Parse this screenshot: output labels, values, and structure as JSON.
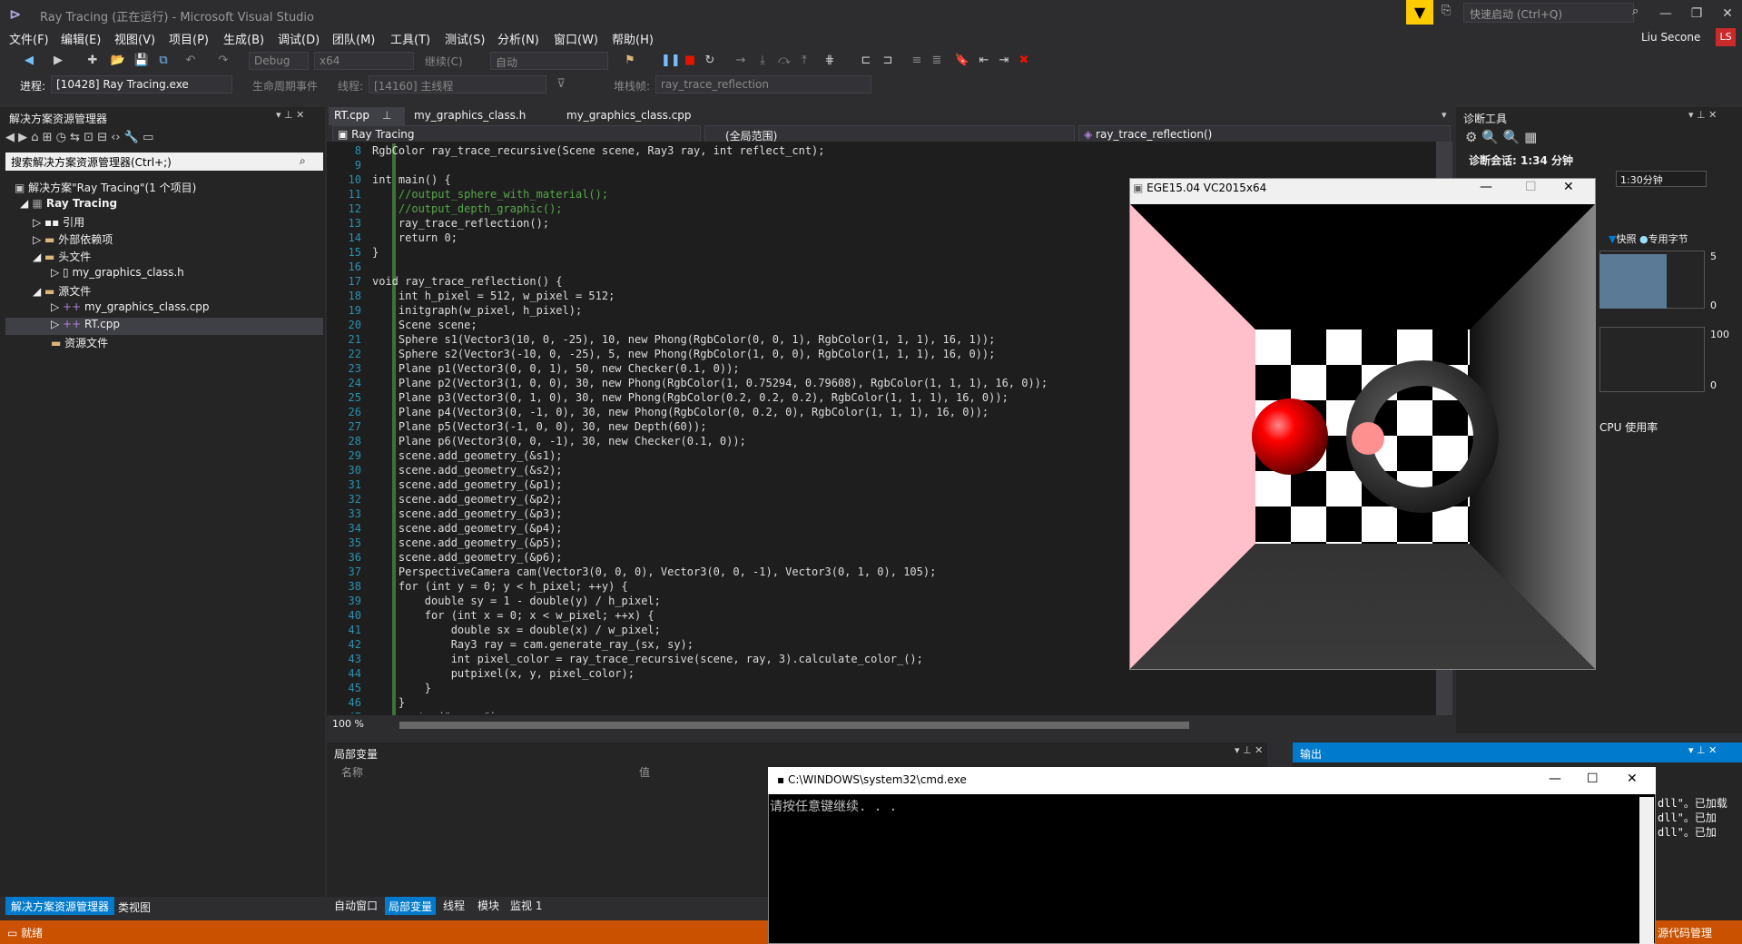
{
  "titlebar": {
    "title": "Ray Tracing (正在运行) - Microsoft Visual Studio",
    "quick_launch_placeholder": "快速启动 (Ctrl+Q)",
    "user": "Liu Secone",
    "avatar": "LS"
  },
  "menu": [
    "文件(F)",
    "编辑(E)",
    "视图(V)",
    "项目(P)",
    "生成(B)",
    "调试(D)",
    "团队(M)",
    "工具(T)",
    "测试(S)",
    "分析(N)",
    "窗口(W)",
    "帮助(H)"
  ],
  "toolbar": {
    "config": "Debug",
    "platform": "x64",
    "continue": "继续(C)",
    "auto": "自动"
  },
  "debugbar": {
    "process_label": "进程:",
    "process": "[10428] Ray Tracing.exe",
    "lifecycle": "生命周期事件",
    "thread_label": "线程:",
    "thread": "[14160] 主线程",
    "stack_label": "堆栈帧:",
    "stack": "ray_trace_reflection"
  },
  "solution": {
    "title": "解决方案资源管理器",
    "search": "搜索解决方案资源管理器(Ctrl+;)",
    "items": [
      {
        "label": "解决方案\"Ray Tracing\"(1 个项目)",
        "indent": 0
      },
      {
        "label": "Ray Tracing",
        "indent": 1
      },
      {
        "label": "引用",
        "indent": 2
      },
      {
        "label": "外部依赖项",
        "indent": 2
      },
      {
        "label": "头文件",
        "indent": 2
      },
      {
        "label": "my_graphics_class.h",
        "indent": 3
      },
      {
        "label": "源文件",
        "indent": 2
      },
      {
        "label": "my_graphics_class.cpp",
        "indent": 3
      },
      {
        "label": "RT.cpp",
        "indent": 3
      },
      {
        "label": "资源文件",
        "indent": 2
      }
    ],
    "bottom_tabs": [
      "解决方案资源管理器",
      "类视图"
    ]
  },
  "editor": {
    "tabs": [
      "RT.cpp",
      "my_graphics_class.h",
      "my_graphics_class.cpp"
    ],
    "nav_project": "Ray Tracing",
    "nav_scope": "(全局范围)",
    "nav_func": "ray_trace_reflection()",
    "zoom": "100 %",
    "lines": [
      [
        "8",
        "RgbColor ray_trace_recursive(Scene scene, Ray3 ray, int reflect_cnt);"
      ],
      [
        "9",
        ""
      ],
      [
        "10",
        "int main() {"
      ],
      [
        "11",
        "    //output_sphere_with_material();"
      ],
      [
        "12",
        "    //output_depth_graphic();"
      ],
      [
        "13",
        "    ray_trace_reflection();"
      ],
      [
        "14",
        "    return 0;"
      ],
      [
        "15",
        "}"
      ],
      [
        "16",
        ""
      ],
      [
        "17",
        "void ray_trace_reflection() {"
      ],
      [
        "18",
        "    int h_pixel = 512, w_pixel = 512;"
      ],
      [
        "19",
        "    initgraph(w_pixel, h_pixel);"
      ],
      [
        "20",
        "    Scene scene;"
      ],
      [
        "21",
        "    Sphere s1(Vector3(10, 0, -25), 10, new Phong(RgbColor(0, 0, 1), RgbColor(1, 1, 1), 16, 1));"
      ],
      [
        "22",
        "    Sphere s2(Vector3(-10, 0, -25), 5, new Phong(RgbColor(1, 0, 0), RgbColor(1, 1, 1), 16, 0));"
      ],
      [
        "23",
        "    Plane p1(Vector3(0, 0, 1), 50, new Checker(0.1, 0));"
      ],
      [
        "24",
        "    Plane p2(Vector3(1, 0, 0), 30, new Phong(RgbColor(1, 0.75294, 0.79608), RgbColor(1, 1, 1), 16, 0));"
      ],
      [
        "25",
        "    Plane p3(Vector3(0, 1, 0), 30, new Phong(RgbColor(0.2, 0.2, 0.2), RgbColor(1, 1, 1), 16, 0));"
      ],
      [
        "26",
        "    Plane p4(Vector3(0, -1, 0), 30, new Phong(RgbColor(0, 0.2, 0), RgbColor(1, 1, 1), 16, 0));"
      ],
      [
        "27",
        "    Plane p5(Vector3(-1, 0, 0), 30, new Depth(60));"
      ],
      [
        "28",
        "    Plane p6(Vector3(0, 0, -1), 30, new Checker(0.1, 0));"
      ],
      [
        "29",
        "    scene.add_geometry_(&s1);"
      ],
      [
        "30",
        "    scene.add_geometry_(&s2);"
      ],
      [
        "31",
        "    scene.add_geometry_(&p1);"
      ],
      [
        "32",
        "    scene.add_geometry_(&p2);"
      ],
      [
        "33",
        "    scene.add_geometry_(&p3);"
      ],
      [
        "34",
        "    scene.add_geometry_(&p4);"
      ],
      [
        "35",
        "    scene.add_geometry_(&p5);"
      ],
      [
        "36",
        "    scene.add_geometry_(&p6);"
      ],
      [
        "37",
        "    PerspectiveCamera cam(Vector3(0, 0, 0), Vector3(0, 0, -1), Vector3(0, 1, 0), 105);"
      ],
      [
        "38",
        "    for (int y = 0; y < h_pixel; ++y) {"
      ],
      [
        "39",
        "        double sy = 1 - double(y) / h_pixel;"
      ],
      [
        "40",
        "        for (int x = 0; x < w_pixel; ++x) {"
      ],
      [
        "41",
        "            double sx = double(x) / w_pixel;"
      ],
      [
        "42",
        "            Ray3 ray = cam.generate_ray_(sx, sy);"
      ],
      [
        "43",
        "            int pixel_color = ray_trace_recursive(scene, ray, 3).calculate_color_();"
      ],
      [
        "44",
        "            putpixel(x, y, pixel_color);"
      ],
      [
        "45",
        "        }"
      ],
      [
        "46",
        "    }"
      ],
      [
        "47",
        "    system(\"pause\");"
      ]
    ]
  },
  "diagnostics": {
    "title": "诊断工具",
    "session": "诊断会话: 1:34 分钟",
    "time1": "1:30分钟",
    "snapshot": "快照",
    "private": "专用字节",
    "val5": "5",
    "val0": "0",
    "val100": "100",
    "val0b": "0",
    "cpu": "CPU 使用率"
  },
  "ege": {
    "title": "EGE15.04 VC2015x64"
  },
  "locals": {
    "title": "局部变量",
    "col_name": "名称",
    "col_value": "值",
    "tabs": [
      "自动窗口",
      "局部变量",
      "线程",
      "模块",
      "监视 1"
    ]
  },
  "output": {
    "title": "输出",
    "lines": [
      "dll\"。已加载",
      "dll\"。已加",
      "dll\"。已加"
    ]
  },
  "cmd": {
    "title": "C:\\WINDOWS\\system32\\cmd.exe",
    "text": "请按任意键继续. . ."
  },
  "status": {
    "text": "就绪",
    "right": "源代码管理"
  },
  "colors": {
    "accent": "#007acc",
    "status": "#ca5100",
    "pink": "#ffc0cb"
  }
}
